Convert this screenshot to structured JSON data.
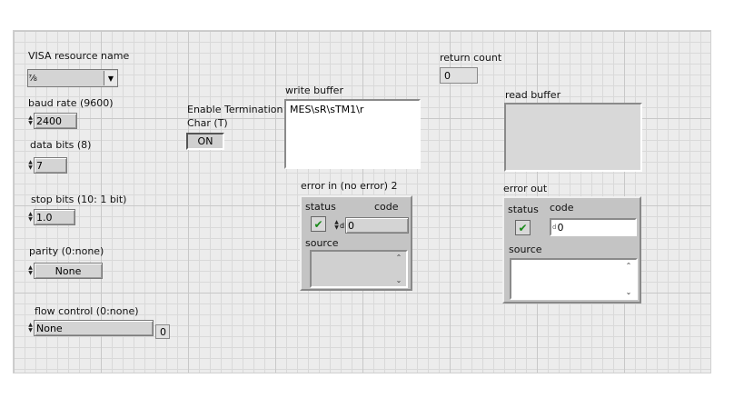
{
  "visa": {
    "label": "VISA resource name",
    "value": "",
    "icon": "visa-resource-icon"
  },
  "baud_rate": {
    "label": "baud rate (9600)",
    "value": "2400"
  },
  "data_bits": {
    "label": "data bits (8)",
    "value": "7"
  },
  "stop_bits": {
    "label": "stop bits (10: 1 bit)",
    "value": "1.0"
  },
  "parity": {
    "label": "parity (0:none)",
    "value": "None"
  },
  "flow_control": {
    "label": "flow control (0:none)",
    "value": "None",
    "index": "0"
  },
  "termination": {
    "label_line1": "Enable Termination",
    "label_line2": "Char (T)",
    "button": "ON"
  },
  "write_buffer": {
    "label": "write buffer",
    "value": "MES\\sR\\sTM1\\r"
  },
  "return_count": {
    "label": "return count",
    "value": "0"
  },
  "read_buffer": {
    "label": "read buffer",
    "value": ""
  },
  "error_in": {
    "label": "error in (no error) 2",
    "status_label": "status",
    "code_label": "code",
    "code_value": "0",
    "radix": "d",
    "source_label": "source",
    "source_value": ""
  },
  "error_out": {
    "label": "error out",
    "status_label": "status",
    "code_label": "code",
    "code_value": "0",
    "radix": "d",
    "source_label": "source",
    "source_value": ""
  },
  "colors": {
    "status_ok": "#1a8a1a",
    "panel_bg": "#ececec",
    "cluster_bg": "#c4c4c4"
  }
}
